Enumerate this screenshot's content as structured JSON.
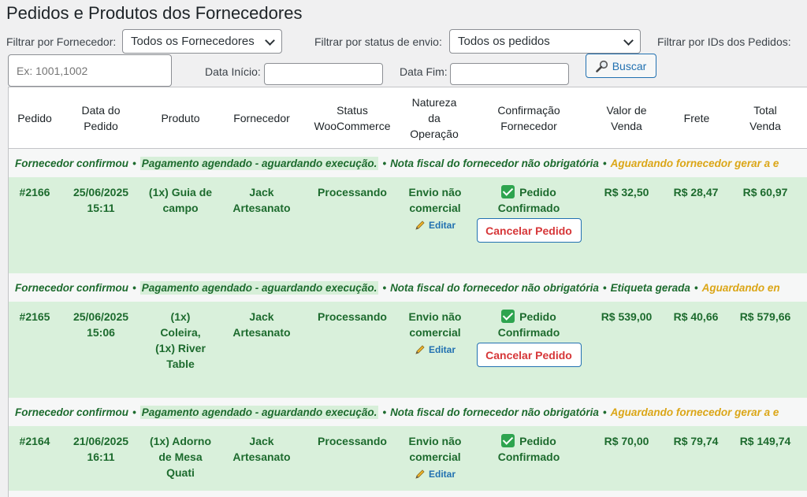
{
  "page": {
    "title": "Pedidos e Produtos dos Fornecedores"
  },
  "filters": {
    "supplier_label": "Filtrar por Fornecedor:",
    "supplier_value": "Todos os Fornecedores",
    "status_label": "Filtrar por status de envio:",
    "status_value": "Todos os pedidos",
    "ids_label": "Filtrar por IDs dos Pedidos:",
    "ids_placeholder": "Ex: 1001,1002",
    "start_label": "Data Início:",
    "end_label": "Data Fim:",
    "search_button": "Buscar"
  },
  "table": {
    "headers": {
      "pedido": "Pedido",
      "data": [
        "Data do",
        "Pedido"
      ],
      "produto": "Produto",
      "fornecedor": "Fornecedor",
      "status": [
        "Status",
        "WooCommerce"
      ],
      "natureza": [
        "Natureza",
        "da",
        "Operação"
      ],
      "confirmacao": [
        "Confirmação",
        "Fornecedor"
      ],
      "valor": [
        "Valor de",
        "Venda"
      ],
      "frete": "Frete",
      "total": [
        "Total",
        "Venda"
      ]
    },
    "orders": [
      {
        "status_line": {
          "confirmed": "Fornecedor confirmou",
          "payment": "Pagamento agendado - aguardando execução.",
          "invoice": "Nota fiscal do fornecedor não obrigatória",
          "label": "",
          "waiting": "Aguardando fornecedor gerar a e"
        },
        "id": "#2166",
        "date": [
          "25/06/2025",
          "15:11"
        ],
        "product": [
          "(1x) Guia de",
          "campo"
        ],
        "supplier": [
          "Jack",
          "Artesanato"
        ],
        "wc_status": "Processando",
        "nature": [
          "Envio não",
          "comercial"
        ],
        "edit": "Editar",
        "confirmation": [
          "Pedido",
          "Confirmado"
        ],
        "cancel": "Cancelar Pedido",
        "value": "R$ 32,50",
        "shipping": "R$ 28,47",
        "total": "R$ 60,97"
      },
      {
        "status_line": {
          "confirmed": "Fornecedor confirmou",
          "payment": "Pagamento agendado - aguardando execução.",
          "invoice": "Nota fiscal do fornecedor não obrigatória",
          "label": "Etiqueta gerada",
          "waiting": "Aguardando en"
        },
        "id": "#2165",
        "date": [
          "25/06/2025",
          "15:06"
        ],
        "product": [
          "(1x)",
          "Coleira,",
          "(1x) River",
          "Table"
        ],
        "supplier": [
          "Jack",
          "Artesanato"
        ],
        "wc_status": "Processando",
        "nature": [
          "Envio não",
          "comercial"
        ],
        "edit": "Editar",
        "confirmation": [
          "Pedido",
          "Confirmado"
        ],
        "cancel": "Cancelar Pedido",
        "value": "R$ 539,00",
        "shipping": "R$ 40,66",
        "total": "R$ 579,66"
      },
      {
        "status_line": {
          "confirmed": "Fornecedor confirmou",
          "payment": "Pagamento agendado - aguardando execução.",
          "invoice": "Nota fiscal do fornecedor não obrigatória",
          "label": "",
          "waiting": "Aguardando fornecedor gerar a e"
        },
        "id": "#2164",
        "date": [
          "21/06/2025",
          "16:11"
        ],
        "product": [
          "(1x) Adorno",
          "de Mesa",
          "Quati"
        ],
        "supplier": [
          "Jack",
          "Artesanato"
        ],
        "wc_status": "Processando",
        "nature": [
          "Envio não",
          "comercial"
        ],
        "edit": "Editar",
        "confirmation": [
          "Pedido",
          "Confirmado"
        ],
        "cancel": "",
        "value": "R$ 70,00",
        "shipping": "R$ 79,74",
        "total": "R$ 149,74"
      }
    ]
  },
  "colors": {
    "accent": "#2271b1",
    "success_bg": "#d9f0db",
    "success_text": "#1d6b2e",
    "warning": "#dba617",
    "danger": "#d63638"
  },
  "icons": {
    "search": "magnifier-icon",
    "edit": "pencil-icon",
    "confirm": "check-icon"
  }
}
